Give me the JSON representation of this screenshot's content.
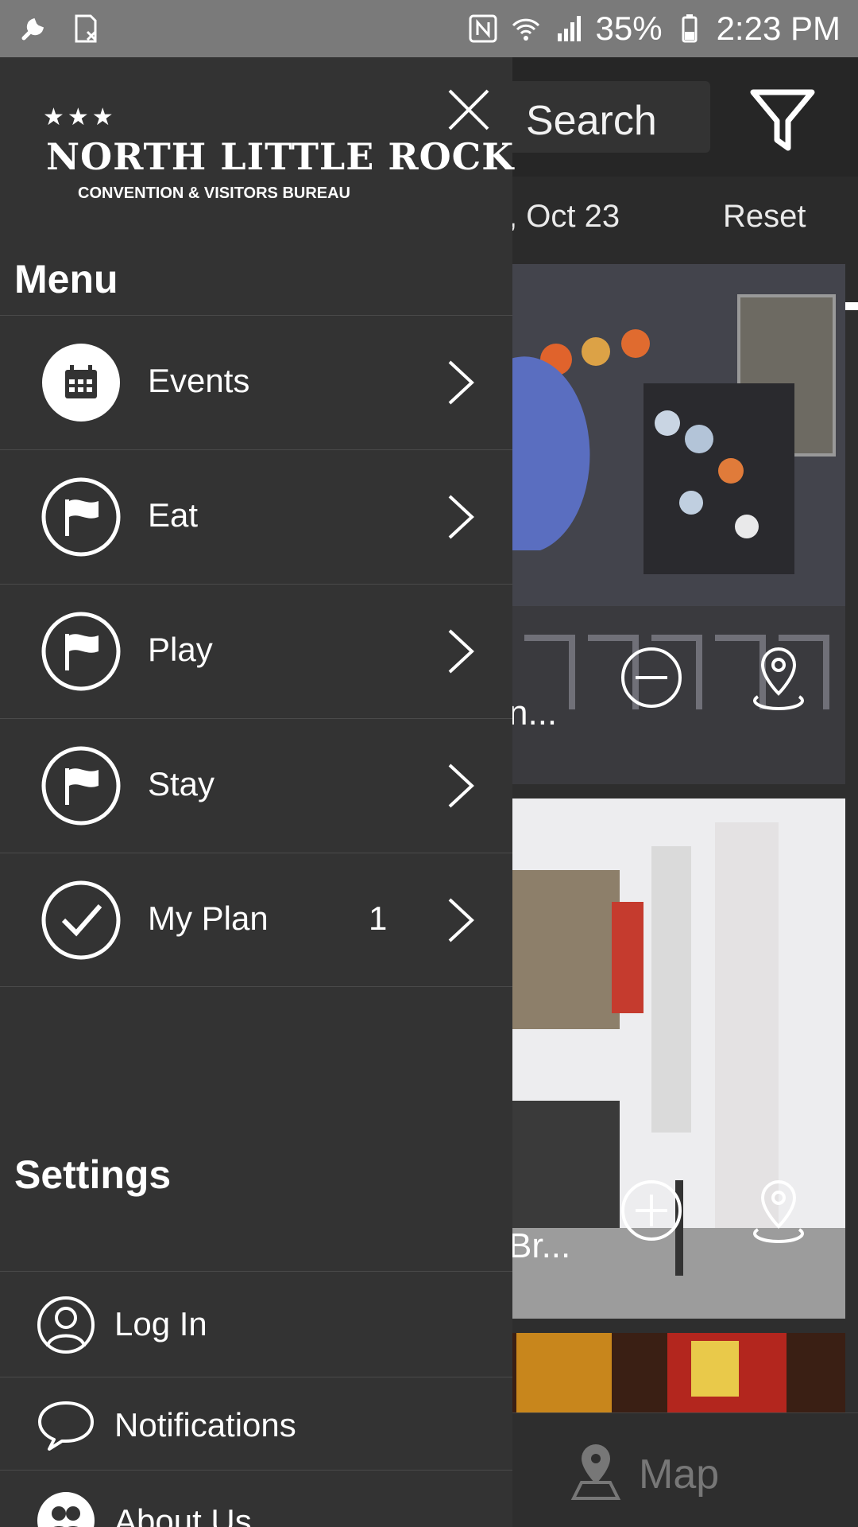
{
  "status_bar": {
    "battery": "35%",
    "time": "2:23 PM",
    "icons": [
      "wrench-icon",
      "sim-icon",
      "nfc-icon",
      "wifi-icon",
      "signal-icon",
      "battery-icon"
    ]
  },
  "background": {
    "search_label": "Search",
    "date_text": ", Oct 23",
    "reset_label": "Reset",
    "cards": [
      {
        "title_fragment": "n...",
        "action": "remove"
      },
      {
        "title_fragment": "Br...",
        "action": "add"
      }
    ],
    "bottom_nav": {
      "map_label": "Map"
    }
  },
  "drawer": {
    "logo": {
      "stars": "★★★",
      "name": "NORTH LITTLE ROCK",
      "subtitle": "CONVENTION & VISITORS BUREAU"
    },
    "menu_title": "Menu",
    "menu_items": [
      {
        "label": "Events",
        "icon": "calendar-icon",
        "count": ""
      },
      {
        "label": "Eat",
        "icon": "flag-icon",
        "count": ""
      },
      {
        "label": "Play",
        "icon": "flag-icon",
        "count": ""
      },
      {
        "label": "Stay",
        "icon": "flag-icon",
        "count": ""
      },
      {
        "label": "My Plan",
        "icon": "checkmark-icon",
        "count": "1"
      }
    ],
    "settings_title": "Settings",
    "settings_items": [
      {
        "label": "Log In",
        "icon": "user-icon"
      },
      {
        "label": "Notifications",
        "icon": "chat-bubble-icon"
      },
      {
        "label": "About Us",
        "icon": "group-icon"
      }
    ]
  },
  "colors": {
    "drawer_bg": "#333333",
    "status_bar_bg": "#7a7a7a",
    "divider": "#4a4a4a",
    "text": "#ffffff"
  }
}
